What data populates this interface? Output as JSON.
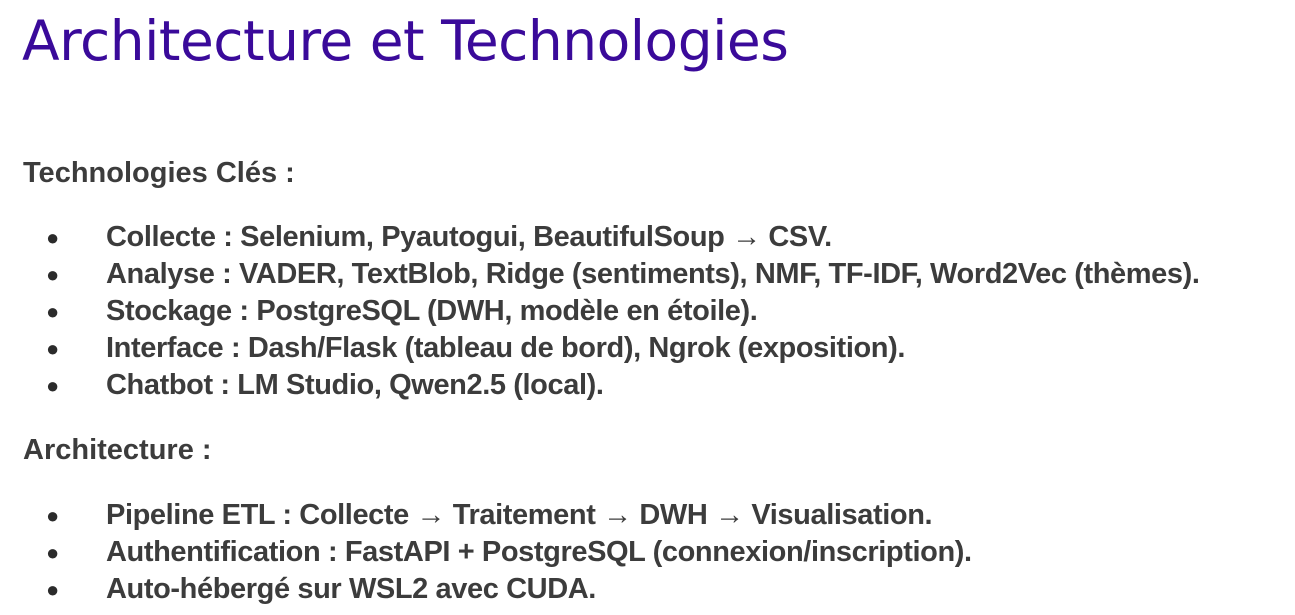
{
  "title": "Architecture et Technologies",
  "sections": [
    {
      "heading": "Technologies Clés :",
      "items": [
        "Collecte : Selenium, Pyautogui, BeautifulSoup → CSV.",
        "Analyse : VADER, TextBlob, Ridge (sentiments), NMF, TF-IDF, Word2Vec (thèmes).",
        "Stockage : PostgreSQL (DWH, modèle en étoile).",
        "Interface : Dash/Flask (tableau de bord), Ngrok (exposition).",
        "Chatbot : LM Studio, Qwen2.5 (local)."
      ]
    },
    {
      "heading": "Architecture :",
      "items": [
        "Pipeline ETL : Collecte → Traitement → DWH → Visualisation.",
        "Authentification : FastAPI + PostgreSQL (connexion/inscription).",
        "Auto-hébergé sur WSL2 avec CUDA."
      ]
    }
  ],
  "bullet_glyph": "●",
  "colors": {
    "title": "#3a0a9a",
    "body_text": "#3c3c3c",
    "background": "#ffffff"
  }
}
